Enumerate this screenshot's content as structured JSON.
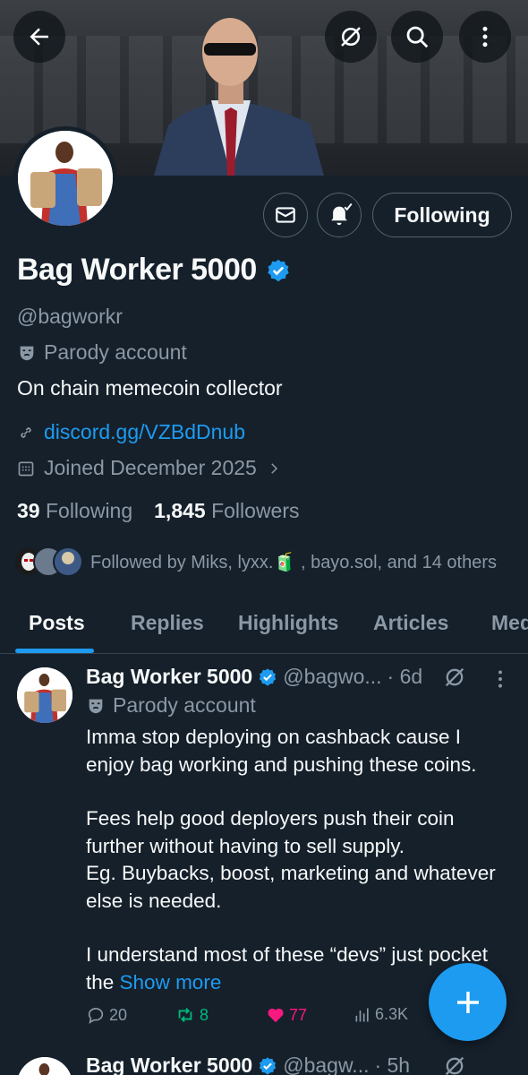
{
  "header": {
    "back_icon": "arrow-left-icon",
    "grok_icon": "grok-icon",
    "search_icon": "search-icon",
    "more_icon": "more-vertical-icon"
  },
  "profile": {
    "display_name": "Bag Worker 5000",
    "handle": "@bagworkr",
    "parody_label": "Parody account",
    "bio": "On chain memecoin collector",
    "link": "discord.gg/VZBdDnub",
    "joined": "Joined December 2025",
    "following_count": "39",
    "following_label": "Following",
    "followers_count": "1,845",
    "followers_label": "Followers",
    "followed_by": "Followed by Miks, lyxx.🧃 , bayo.sol, and 14 others",
    "follow_button": "Following"
  },
  "tabs": [
    "Posts",
    "Replies",
    "Highlights",
    "Articles",
    "Media"
  ],
  "post": {
    "name": "Bag Worker 5000",
    "handle": "@bagwo...",
    "time": "· 6d",
    "parody_label": "Parody account",
    "paragraphs": [
      "Imma stop deploying on cashback cause I enjoy bag working and pushing these coins.",
      "Fees help good deployers push their coin further without having to sell supply.\nEg. Buybacks, boost, marketing and whatever else is needed.",
      "I understand most of these “devs” just pocket the "
    ],
    "show_more": "Show more",
    "replies": "20",
    "reposts": "8",
    "likes": "77",
    "views": "6.3K"
  },
  "post2": {
    "name": "Bag Worker 5000",
    "handle": "@bagw...",
    "time": "· 5h"
  },
  "colors": {
    "background": "#15202b",
    "accent": "#1d9bf0",
    "muted": "#8b98a5",
    "repost_green": "#00ba7c",
    "like_pink": "#f91880"
  }
}
